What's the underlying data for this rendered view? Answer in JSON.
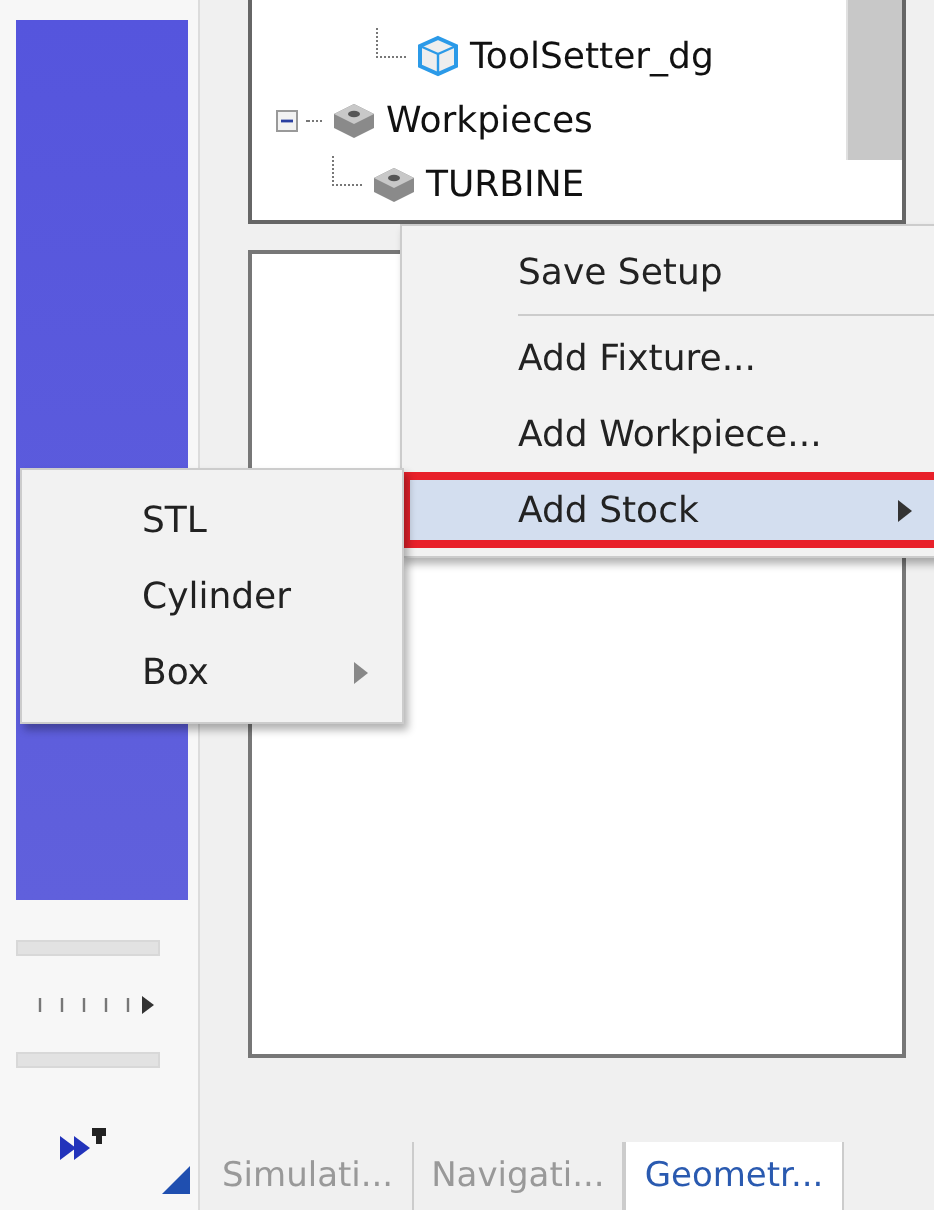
{
  "tree": {
    "scrolled_children": [
      {
        "label": "ToolSetter_dg",
        "kind": "tool"
      }
    ],
    "items": [
      {
        "label": "Workpieces",
        "kind": "workpiece",
        "expanded": true,
        "children": [
          {
            "label": "TURBINE",
            "kind": "workpiece"
          }
        ]
      }
    ]
  },
  "context_menu": [
    {
      "kind": "item",
      "label": "Save Setup",
      "selected": false,
      "submenu": false
    },
    {
      "kind": "separator"
    },
    {
      "kind": "item",
      "label": "Add Fixture...",
      "selected": false,
      "submenu": false
    },
    {
      "kind": "item",
      "label": "Add Workpiece...",
      "selected": false,
      "submenu": false
    },
    {
      "kind": "item",
      "label": "Add Stock",
      "selected": true,
      "submenu": true
    }
  ],
  "submenu": [
    {
      "label": "STL",
      "submenu": false
    },
    {
      "label": "Cylinder",
      "submenu": false
    },
    {
      "label": "Box",
      "submenu": true
    }
  ],
  "tabs": [
    {
      "label": "Simulati...",
      "selected": false
    },
    {
      "label": "Navigati...",
      "selected": false
    },
    {
      "label": "Geometr...",
      "selected": true
    }
  ]
}
